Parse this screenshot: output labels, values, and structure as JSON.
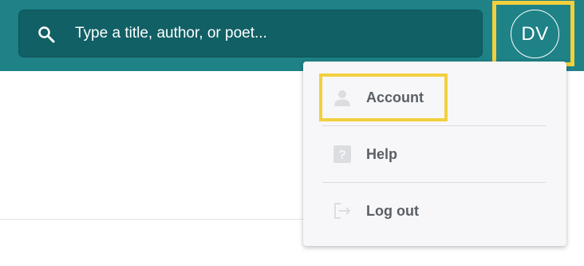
{
  "search": {
    "placeholder": "Type a title, author, or poet..."
  },
  "user": {
    "initials": "DV"
  },
  "menu": {
    "items": [
      {
        "label": "Account",
        "icon": "person-icon"
      },
      {
        "label": "Help",
        "icon": "help-icon"
      },
      {
        "label": "Log out",
        "icon": "logout-icon"
      }
    ]
  },
  "colors": {
    "topbar": "#1e8287",
    "search_bg": "#116065",
    "highlight": "#f2cf3d",
    "menu_bg": "#f7f7f9",
    "menu_text": "#5a5f66"
  }
}
